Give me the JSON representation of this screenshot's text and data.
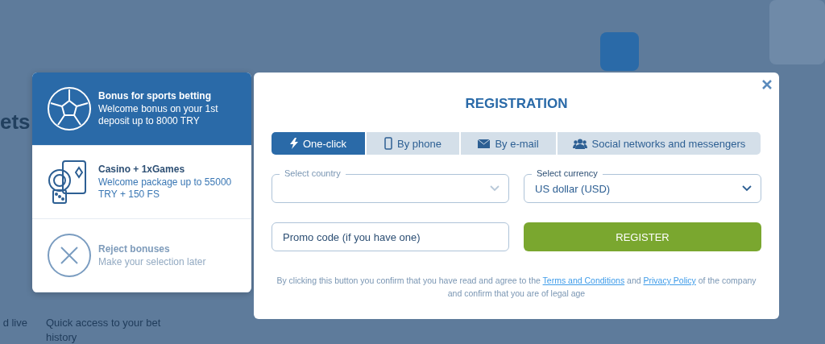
{
  "background": {
    "heading": "ets",
    "texts": [
      "d live",
      "Quick access to your bet history"
    ]
  },
  "bonus_panel": {
    "items": [
      {
        "kind": "sports",
        "title": "Bonus for sports betting",
        "description": "Welcome bonus on your 1st deposit up to 8000 TRY",
        "selected": true
      },
      {
        "kind": "casino",
        "title": "Casino + 1xGames",
        "description": "Welcome package up to 55000 TRY + 150 FS",
        "selected": false
      },
      {
        "kind": "reject",
        "title": "Reject bonuses",
        "description": "Make your selection later",
        "selected": false
      }
    ]
  },
  "registration": {
    "title": "REGISTRATION",
    "tabs": [
      {
        "kind": "bolt",
        "label": "One-click",
        "selected": true
      },
      {
        "kind": "phone",
        "label": "By phone",
        "selected": false
      },
      {
        "kind": "mail",
        "label": "By e-mail",
        "selected": false
      },
      {
        "kind": "people",
        "label": "Social networks and messengers",
        "selected": false
      }
    ],
    "country": {
      "label": "Select country"
    },
    "currency": {
      "label": "Select currency",
      "value": "US dollar (USD)"
    },
    "promo": {
      "placeholder": "Promo code (if you have one)"
    },
    "register_button": "REGISTER",
    "disclaimer": [
      {
        "kind": "text",
        "text": "By clicking this button you confirm that you have read and agree to the "
      },
      {
        "kind": "link",
        "text": "Terms and Conditions"
      },
      {
        "kind": "text",
        "text": " and "
      },
      {
        "kind": "link",
        "text": "Privacy Policy"
      },
      {
        "kind": "text",
        "text": " of the company and confirm that you are of legal age"
      }
    ]
  }
}
